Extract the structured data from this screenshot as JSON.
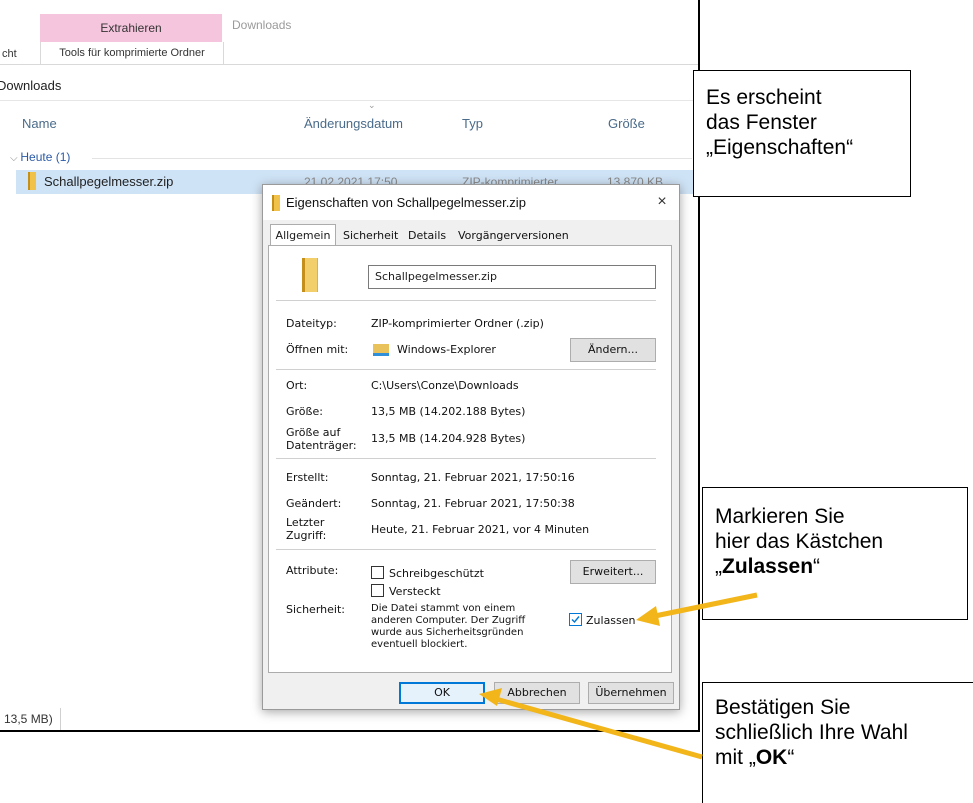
{
  "explorer": {
    "ribbon": {
      "extract_tab": "Extrahieren",
      "context_title": "Downloads",
      "left_tab_fragment": "cht",
      "tools_tab": "Tools für komprimierte Ordner"
    },
    "breadcrumb": "Downloads",
    "columns": {
      "name": "Name",
      "date": "Änderungsdatum",
      "type": "Typ",
      "size": "Größe"
    },
    "group": "Heute (1)",
    "file_row": {
      "name": "Schallpegelmesser.zip",
      "date": "21.02.2021 17:50",
      "type": "ZIP-komprimierter...",
      "size": "13.870 KB"
    },
    "status_size": "13,5 MB)"
  },
  "dialog": {
    "title": "Eigenschaften von Schallpegelmesser.zip",
    "close": "×",
    "tabs": [
      {
        "label": "Allgemein",
        "active": true
      },
      {
        "label": "Sicherheit",
        "active": false
      },
      {
        "label": "Details",
        "active": false
      },
      {
        "label": "Vorgängerversionen",
        "active": false
      }
    ],
    "filename": "Schallpegelmesser.zip",
    "fields": {
      "dateityp_label": "Dateityp:",
      "dateityp_value": "ZIP-komprimierter Ordner (.zip)",
      "oeffnen_label": "Öffnen mit:",
      "oeffnen_value": "Windows-Explorer",
      "aendern_button": "Ändern...",
      "ort_label": "Ort:",
      "ort_value": "C:\\Users\\Conze\\Downloads",
      "groesse_label": "Größe:",
      "groesse_value": "13,5 MB (14.202.188 Bytes)",
      "groesse_dt_label_1": "Größe auf",
      "groesse_dt_label_2": "Datenträger:",
      "groesse_dt_value": "13,5 MB (14.204.928 Bytes)",
      "erstellt_label": "Erstellt:",
      "erstellt_value": "Sonntag, 21. Februar 2021, 17:50:16",
      "geaendert_label": "Geändert:",
      "geaendert_value": "Sonntag, 21. Februar 2021, 17:50:38",
      "zugriff_label_1": "Letzter",
      "zugriff_label_2": "Zugriff:",
      "zugriff_value": "Heute, 21. Februar 2021, vor 4 Minuten",
      "attribute_label": "Attribute:",
      "schreibgeschuetzt": "Schreibgeschützt",
      "versteckt": "Versteckt",
      "erweitert_button": "Erweitert...",
      "sicherheit_label": "Sicherheit:",
      "sicherheit_text_1": "Die Datei stammt von einem",
      "sicherheit_text_2": "anderen Computer. Der Zugriff",
      "sicherheit_text_3": "wurde aus Sicherheitsgründen",
      "sicherheit_text_4": "eventuell blockiert.",
      "zulassen": "Zulassen",
      "zulassen_checked": true
    },
    "buttons": {
      "ok": "OK",
      "cancel": "Abbrechen",
      "apply": "Übernehmen"
    }
  },
  "annotations": {
    "note1": {
      "line1": "Es erscheint",
      "line2": "das Fenster",
      "line3": "„Eigenschaften“"
    },
    "note2": {
      "line1": "Markieren Sie",
      "line2": "hier das Kästchen",
      "open_quote": "„",
      "bold": "Zulassen",
      "close_quote": "“"
    },
    "note3": {
      "line1": "Bestätigen Sie",
      "line2": "schließlich Ihre Wahl",
      "prefix": "mit „",
      "bold": "OK",
      "close_quote": "“"
    }
  },
  "colors": {
    "arrow": "#f2b51a",
    "ribbon_accent": "#f5c5dd",
    "selection": "#cfe3f6"
  }
}
